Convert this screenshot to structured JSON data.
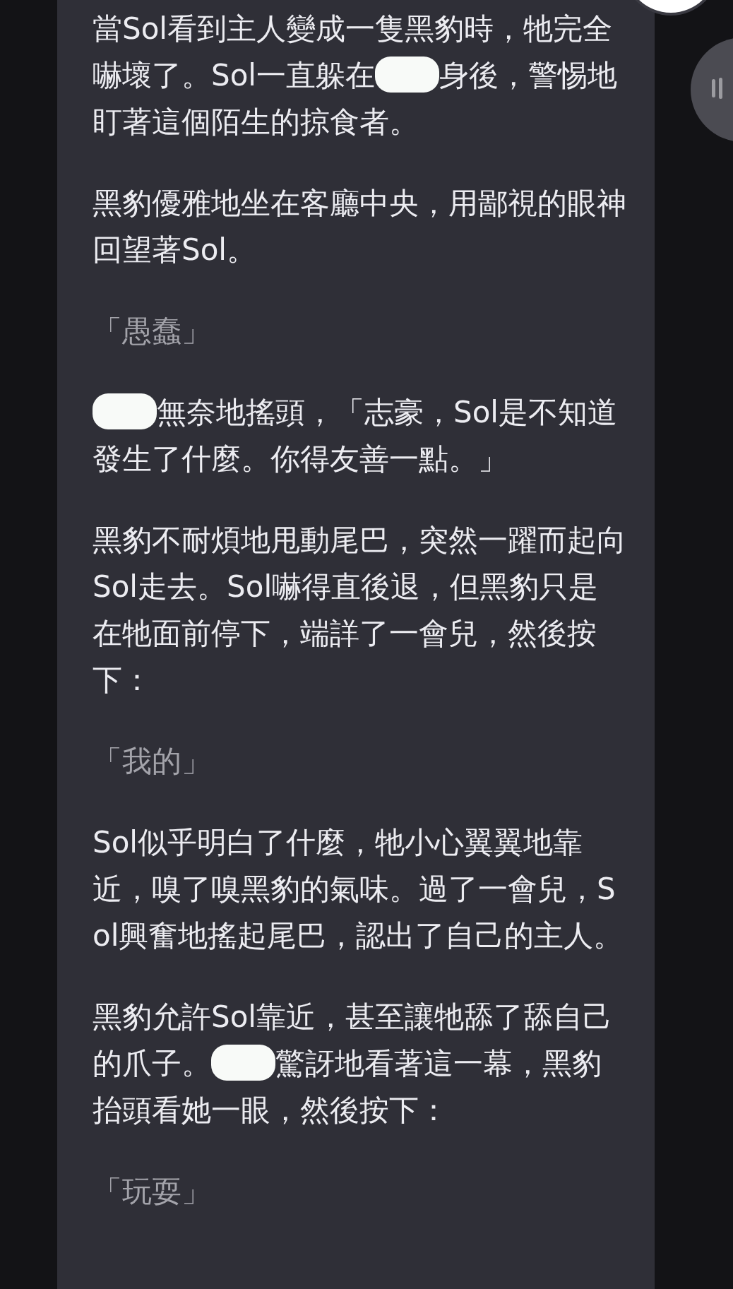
{
  "paragraphs": [
    {
      "kind": "narration",
      "segments": [
        {
          "kind": "text",
          "text": "當Sol看到主人變成一隻黑豹時，牠完全嚇壞了。Sol一直躲在"
        },
        {
          "kind": "redaction"
        },
        {
          "kind": "text",
          "text": "身後，警惕地盯著這個陌生的掠食者。"
        }
      ]
    },
    {
      "kind": "narration",
      "segments": [
        {
          "kind": "text",
          "text": "黑豹優雅地坐在客廳中央，用鄙視的眼神回望著Sol。"
        }
      ]
    },
    {
      "kind": "quote",
      "segments": [
        {
          "kind": "text",
          "text": "「愚蠢」"
        }
      ]
    },
    {
      "kind": "narration",
      "segments": [
        {
          "kind": "redaction"
        },
        {
          "kind": "text",
          "text": "無奈地搖頭，「志豪，Sol是不知道發生了什麼。你得友善一點。」"
        }
      ]
    },
    {
      "kind": "narration",
      "segments": [
        {
          "kind": "text",
          "text": "黑豹不耐煩地甩動尾巴，突然一躍而起向Sol走去。Sol嚇得直後退，但黑豹只是在牠面前停下，端詳了一會兒，然後按下："
        }
      ]
    },
    {
      "kind": "quote",
      "segments": [
        {
          "kind": "text",
          "text": "「我的」"
        }
      ]
    },
    {
      "kind": "narration",
      "segments": [
        {
          "kind": "text",
          "text": "Sol似乎明白了什麼，牠小心翼翼地靠近，嗅了嗅黑豹的氣味。過了一會兒，Sol興奮地搖起尾巴，認出了自己的主人。"
        }
      ]
    },
    {
      "kind": "narration",
      "segments": [
        {
          "kind": "text",
          "text": "黑豹允許Sol靠近，甚至讓牠舔了舔自己的爪子。"
        },
        {
          "kind": "redaction"
        },
        {
          "kind": "text",
          "text": "驚訝地看著這一幕，黑豹抬頭看她一眼，然後按下："
        }
      ]
    },
    {
      "kind": "quote",
      "segments": [
        {
          "kind": "text",
          "text": "「玩耍」"
        }
      ]
    }
  ]
}
